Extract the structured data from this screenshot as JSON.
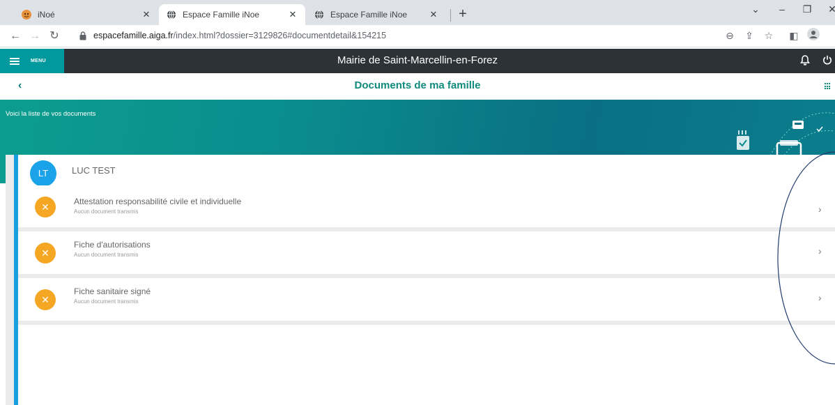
{
  "browser": {
    "tabs": [
      {
        "title": "iNoé",
        "active": false
      },
      {
        "title": "Espace Famille iNoe",
        "active": true
      },
      {
        "title": "Espace Famille iNoe",
        "active": false
      }
    ],
    "url_domain": "espacefamille.aiga.fr",
    "url_path": "/index.html?dossier=3129826#documentdetail&154215"
  },
  "header": {
    "menu_label": "MENU",
    "title": "Mairie de Saint-Marcellin-en-Forez"
  },
  "subheader": {
    "title": "Documents de ma famille"
  },
  "banner": {
    "text": "Voici la liste de vos documents"
  },
  "person": {
    "initials": "LT",
    "name": "LUC TEST"
  },
  "documents": [
    {
      "title": "Attestation responsabilité civile et individuelle",
      "status": "Aucun document transmis"
    },
    {
      "title": "Fiche d'autorisations",
      "status": "Aucun document transmis"
    },
    {
      "title": "Fiche sanitaire signé",
      "status": "Aucun document transmis"
    }
  ],
  "colors": {
    "accent": "#009a9e",
    "header_bg": "#2d3237",
    "title_green": "#0f8a7d",
    "avatar_blue": "#1aa3e8",
    "status_orange": "#f5a623"
  }
}
